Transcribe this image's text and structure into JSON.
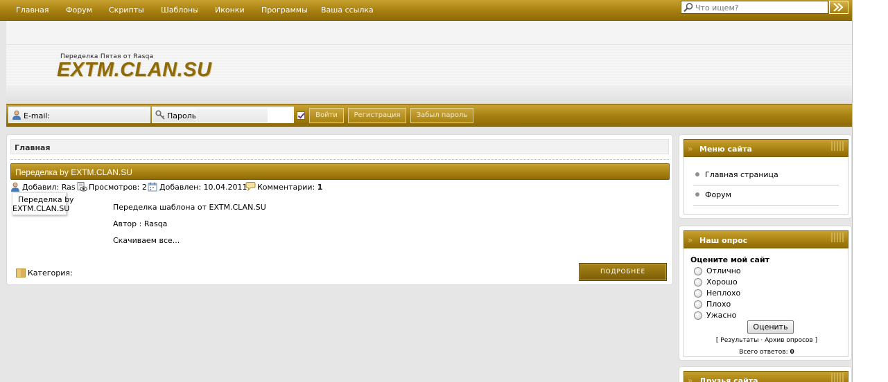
{
  "nav": {
    "items": [
      "Главная",
      "Форум",
      "Скрипты",
      "Шаблоны",
      "Иконки",
      "Программы",
      "Ваша ссылка"
    ]
  },
  "search": {
    "placeholder": "Что ищем?"
  },
  "header": {
    "subtitle": "Переделка Пятая от Rasqa",
    "logo": "EXTM.CLAN.SU"
  },
  "login": {
    "email_label": "E-mail:",
    "password_label": "Пароль:",
    "login_button": "Войти",
    "register_button": "Регистрация",
    "forgot_button": "Забыл пароль"
  },
  "content": {
    "breadcrumb": "Главная",
    "entry": {
      "title": "Переделка by EXTM.CLAN.SU",
      "author_label": "Добавил:",
      "author": "Ras",
      "views_label": "Просмотров:",
      "views": "2",
      "date_label": "Добавлен:",
      "date": "10.04.2011",
      "comments_label": "Комментарии:",
      "comments": "1",
      "thumb_line1": "Переделка by",
      "thumb_line2": "EXTM.CLAN.SU",
      "body": [
        "Переделка шаблона от EXTM.CLAN.SU",
        "Автор : Rasqa",
        "Скачиваем все..."
      ],
      "category_label": "Категория:",
      "more_button": "ПОДРОБНЕЕ"
    }
  },
  "sidebar": {
    "menu": {
      "title": "Меню сайта",
      "items": [
        "Главная страница",
        "Форум"
      ]
    },
    "poll": {
      "title": "Наш опрос",
      "question": "Оцените мой сайт",
      "options": [
        "Отлично",
        "Хорошо",
        "Неплохо",
        "Плохо",
        "Ужасно"
      ],
      "vote_button": "Оценить",
      "results_link": "Результаты",
      "separator": "·",
      "archive_link": "Архив опросов",
      "total_label": "Всего ответов:",
      "total": "0"
    },
    "friends": {
      "title": "Друзья сайта"
    }
  },
  "colors": {
    "gold_light": "#c7a12f",
    "gold_dark": "#8f6b06",
    "logo_gold": "#8d6a0b"
  }
}
